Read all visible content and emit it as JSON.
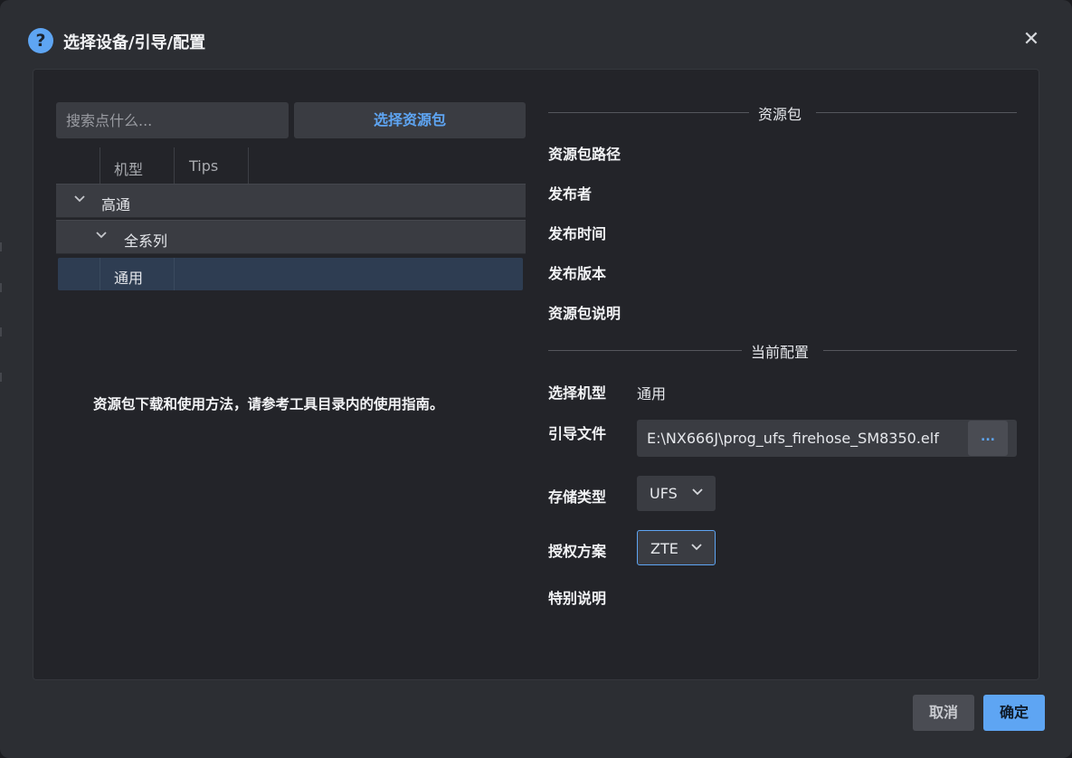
{
  "dialog": {
    "title": "选择设备/引导/配置",
    "help_icon": "question-icon",
    "close_icon": "close-icon",
    "close_glyph": "✕"
  },
  "left": {
    "search_placeholder": "搜索点什么...",
    "select_package_label": "选择资源包",
    "columns": [
      "机型",
      "Tips"
    ],
    "tree": {
      "level1": "高通",
      "level2": "全系列",
      "selected_item": "通用"
    },
    "hint": "资源包下载和使用方法，请参考工具目录内的使用指南。"
  },
  "right": {
    "package_section": {
      "title": "资源包",
      "fields": [
        "资源包路径",
        "发布者",
        "发布时间",
        "发布版本",
        "资源包说明"
      ]
    },
    "config_section": {
      "title": "当前配置",
      "model_label": "选择机型",
      "model_value": "通用",
      "loader_label": "引导文件",
      "loader_value": "E:\\NX666J\\prog_ufs_firehose_SM8350.elf",
      "browse_label": "...",
      "storage_label": "存储类型",
      "storage_value": "UFS",
      "auth_label": "授权方案",
      "auth_value": "ZTE",
      "note_label": "特别说明"
    }
  },
  "footer": {
    "cancel_label": "取消",
    "ok_label": "确定"
  },
  "colors": {
    "accent": "#5ea5f3",
    "dialog_bg": "#2c2e33",
    "panel_bg": "#232429",
    "control_bg": "#3a3c42",
    "selected_row": "#2e3d52"
  }
}
